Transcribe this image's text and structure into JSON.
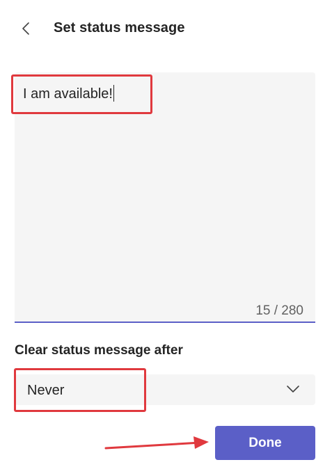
{
  "header": {
    "title": "Set status message",
    "back_icon": "chevron-left-icon"
  },
  "message": {
    "value": "I am available!",
    "counter": "15 / 280"
  },
  "clear_after": {
    "label": "Clear status message after",
    "selected": "Never",
    "dropdown_icon": "chevron-down-icon"
  },
  "actions": {
    "done_label": "Done"
  },
  "colors": {
    "accent": "#5b5fc7",
    "field_bg": "#f5f5f5",
    "annotation": "#e0393e"
  }
}
